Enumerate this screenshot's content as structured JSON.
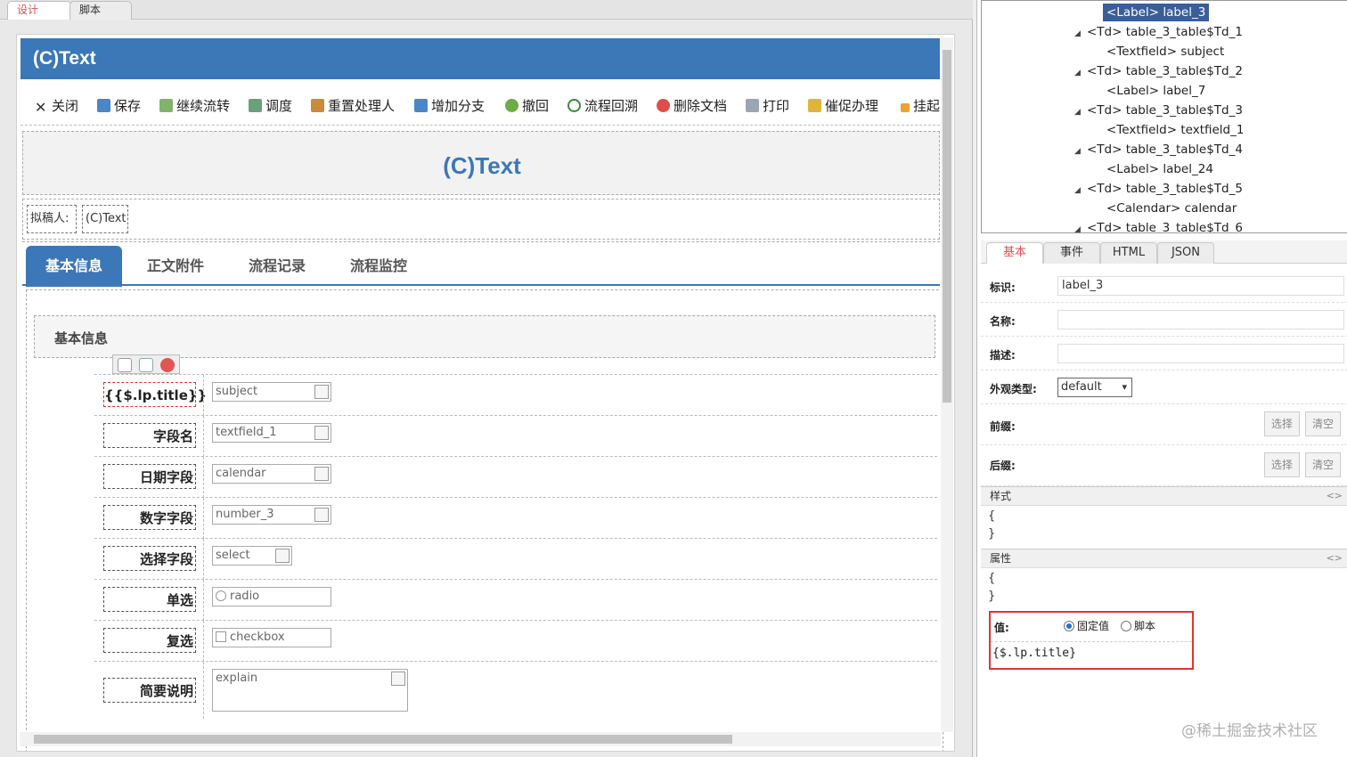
{
  "top_tabs": {
    "design": "设计",
    "script": "脚本"
  },
  "form": {
    "title_bar": "(C)Text",
    "big_title": "(C)Text",
    "draft_label": "拟稿人:",
    "draft_value": "(C)Text"
  },
  "toolbar": {
    "items": [
      "关闭",
      "保存",
      "继续流转",
      "调度",
      "重置处理人",
      "增加分支",
      "撤回",
      "流程回溯",
      "删除文档",
      "打印",
      "催促办理",
      "挂起"
    ]
  },
  "form_tabs": [
    "基本信息",
    "正文附件",
    "流程记录",
    "流程监控"
  ],
  "section_title": "基本信息",
  "fields": [
    {
      "label": "{{$.lp.title}}",
      "input": "subject"
    },
    {
      "label": "字段名",
      "input": "textfield_1"
    },
    {
      "label": "日期字段",
      "input": "calendar"
    },
    {
      "label": "数字字段",
      "input": "number_3"
    },
    {
      "label": "选择字段",
      "input": "select"
    },
    {
      "label": "单选",
      "input": "radio"
    },
    {
      "label": "复选",
      "input": "checkbox"
    },
    {
      "label": "简要说明",
      "input": "explain"
    }
  ],
  "tree": {
    "nodes": [
      {
        "text": "<Label> label_3",
        "selected": true
      },
      {
        "text": "<Td> table_3_table$Td_1"
      },
      {
        "text": "<Textfield> subject"
      },
      {
        "text": "<Td> table_3_table$Td_2"
      },
      {
        "text": "<Label> label_7"
      },
      {
        "text": "<Td> table_3_table$Td_3"
      },
      {
        "text": "<Textfield> textfield_1"
      },
      {
        "text": "<Td> table_3_table$Td_4"
      },
      {
        "text": "<Label> label_24"
      },
      {
        "text": "<Td> table_3_table$Td_5"
      },
      {
        "text": "<Calendar> calendar"
      },
      {
        "text": "<Td> table_3_table$Td_6"
      }
    ]
  },
  "props": {
    "tabs": [
      "基本",
      "事件",
      "HTML",
      "JSON"
    ],
    "id_label": "标识:",
    "id_value": "label_3",
    "name_label": "名称:",
    "desc_label": "描述:",
    "appearance_label": "外观类型:",
    "appearance_value": "default",
    "prefix_label": "前缀:",
    "suffix_label": "后缀:",
    "choose": "选择",
    "clear": "清空",
    "style_header": "样式",
    "attr_header": "属性",
    "toggle": "<>",
    "brace_open": "{",
    "brace_close": "}",
    "value_label": "值:",
    "radio_fixed": "固定值",
    "radio_script": "脚本",
    "value_text": "{$.lp.title}"
  },
  "watermark": "@稀土掘金技术社区",
  "colors": {
    "brand": "#3c77b8",
    "highlight": "#e03333",
    "tab_active_text": "#d9534f"
  }
}
